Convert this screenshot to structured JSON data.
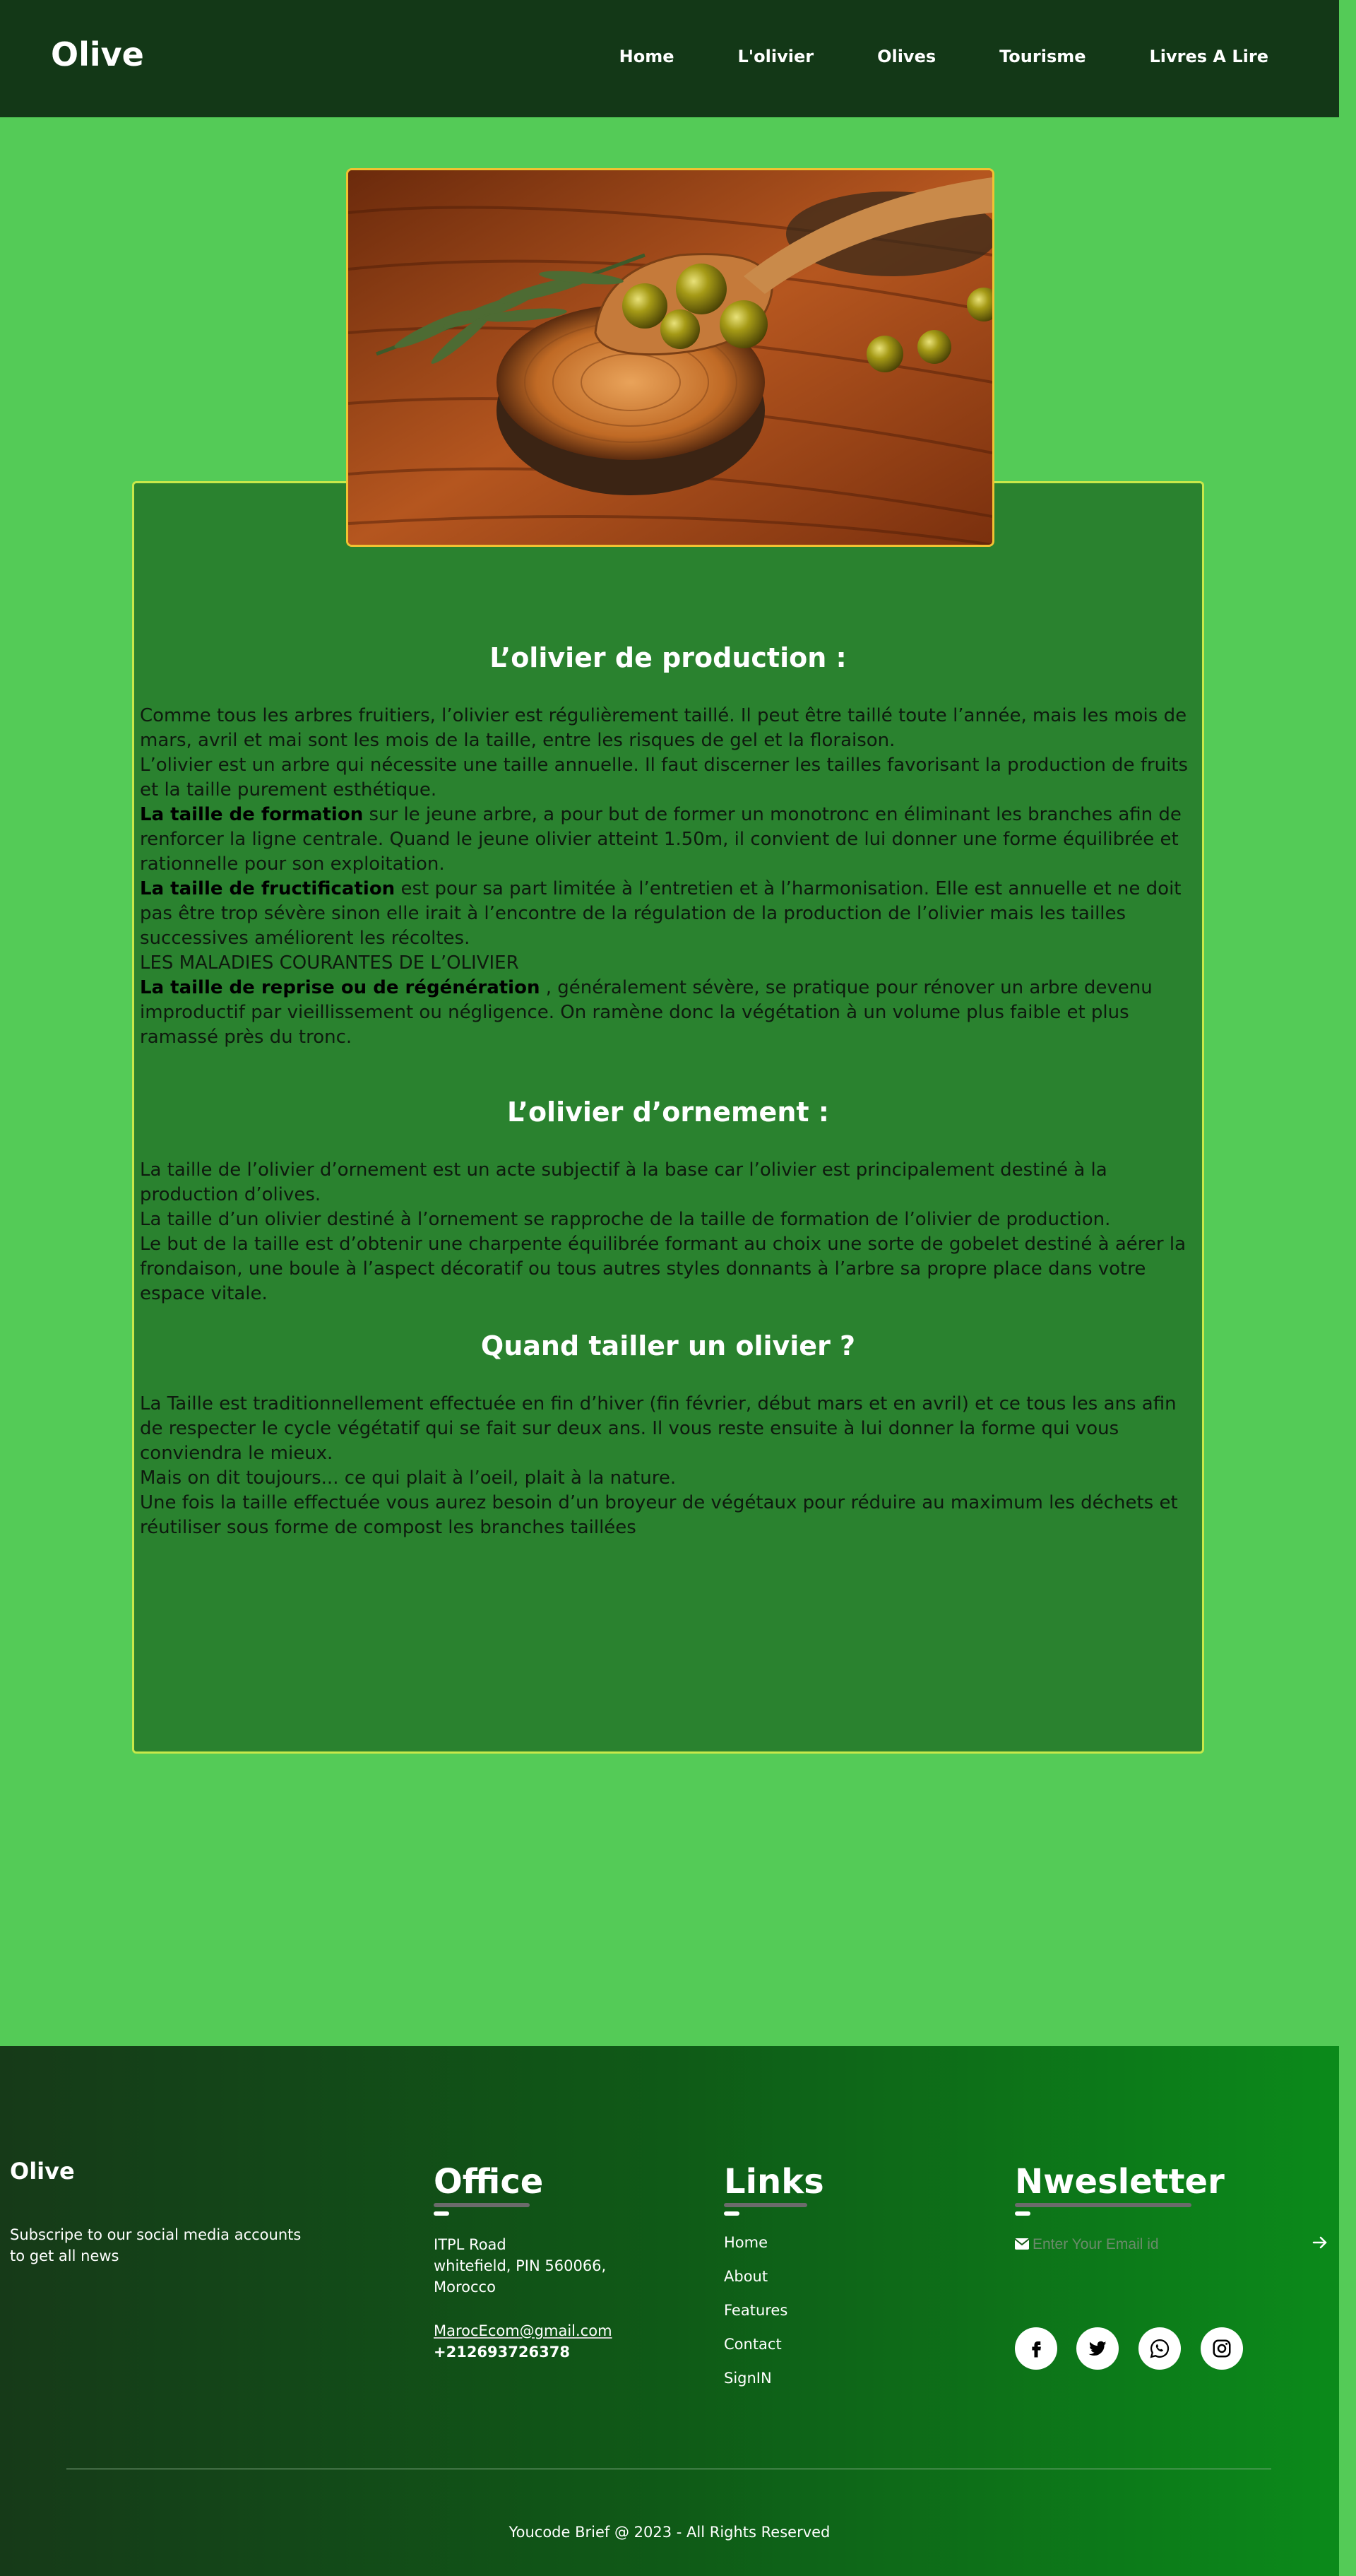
{
  "nav": {
    "brand": "Olive",
    "links": [
      "Home",
      "L'olivier",
      "Olives",
      "Tourisme",
      "Livres A Lire"
    ]
  },
  "sections": {
    "production": {
      "title": "L’olivier de production :",
      "p1": "Comme tous les arbres fruitiers, l’olivier est régulièrement taillé. Il peut être taillé toute l’année, mais les mois de mars, avril et mai sont les mois de la taille, entre les risques de gel et la floraison.",
      "p2": "L’olivier est un arbre qui nécessite une taille annuelle. Il faut discerner les tailles favorisant la production de fruits et la taille purement esthétique.",
      "p3_bold": "La taille de formation",
      "p3": " sur le jeune arbre, a pour but de former un monotronc en éliminant les branches afin de renforcer la ligne centrale. Quand le jeune olivier atteint 1.50m, il convient de lui donner une forme équilibrée et rationnelle pour son exploitation.",
      "p4_bold": "La taille de fructification",
      "p4": " est pour sa part limitée à l’entretien et à l’harmonisation. Elle est annuelle et ne doit pas être trop sévère sinon elle irait à l’encontre de la régulation de la production de l’olivier mais les tailles successives améliorent les récoltes.",
      "p5": "LES MALADIES COURANTES DE L’OLIVIER",
      "p6_bold": "La taille de reprise ou de régénération",
      "p6": " , généralement sévère, se pratique pour rénover un arbre devenu improductif par vieillissement ou négligence. On ramène donc la végétation à un volume plus faible et plus ramassé près du tronc."
    },
    "ornement": {
      "title": "L’olivier d’ornement :",
      "p1": "La taille de l’olivier d’ornement est un acte subjectif à la base car l’olivier est principalement destiné à la production d’olives.",
      "p2": "La taille d’un olivier destiné à l’ornement se rapproche de la taille de formation de l’olivier de production.",
      "p3": "Le but de la taille est d’obtenir une charpente équilibrée formant au choix une sorte de gobelet destiné à aérer la frondaison, une boule à l’aspect décoratif ou tous autres styles donnants à l’arbre sa propre place dans votre espace vitale."
    },
    "quand": {
      "title": "Quand tailler un olivier ?",
      "p1": "La Taille est traditionnellement effectuée en fin d’hiver (fin février, début mars et en avril) et ce tous les ans afin de respecter le cycle végétatif qui se fait sur deux ans. Il vous reste ensuite à lui donner la forme qui vous conviendra le mieux.",
      "p2": "Mais on dit toujours... ce qui plait à l’oeil, plait à la nature.",
      "p3": "Une fois la taille effectuée vous aurez besoin d’un broyeur de végétaux pour réduire au maximum les déchets et réutiliser sous forme de compost les branches taillées"
    }
  },
  "footer": {
    "brand": "Olive",
    "subscribe": "Subscripe to our social media accounts to get all news",
    "office": {
      "title": "Office",
      "address1": "ITPL Road",
      "address2": "whitefield, PIN 560066,",
      "address3": "Morocco",
      "email": " MarocEcom@gmail.com",
      "phone": "+212693726378"
    },
    "links": {
      "title": "Links",
      "items": [
        "Home",
        "About",
        "Features",
        "Contact",
        "SignIN"
      ]
    },
    "newsletter": {
      "title": "Nwesletter",
      "placeholder": "Enter Your Email id"
    },
    "social_icons": [
      "facebook-icon",
      "twitter-icon",
      "whatsapp-icon",
      "instagram-icon"
    ],
    "copyright": "Youcode Brief @ 2023 - All Rights Reserved"
  }
}
